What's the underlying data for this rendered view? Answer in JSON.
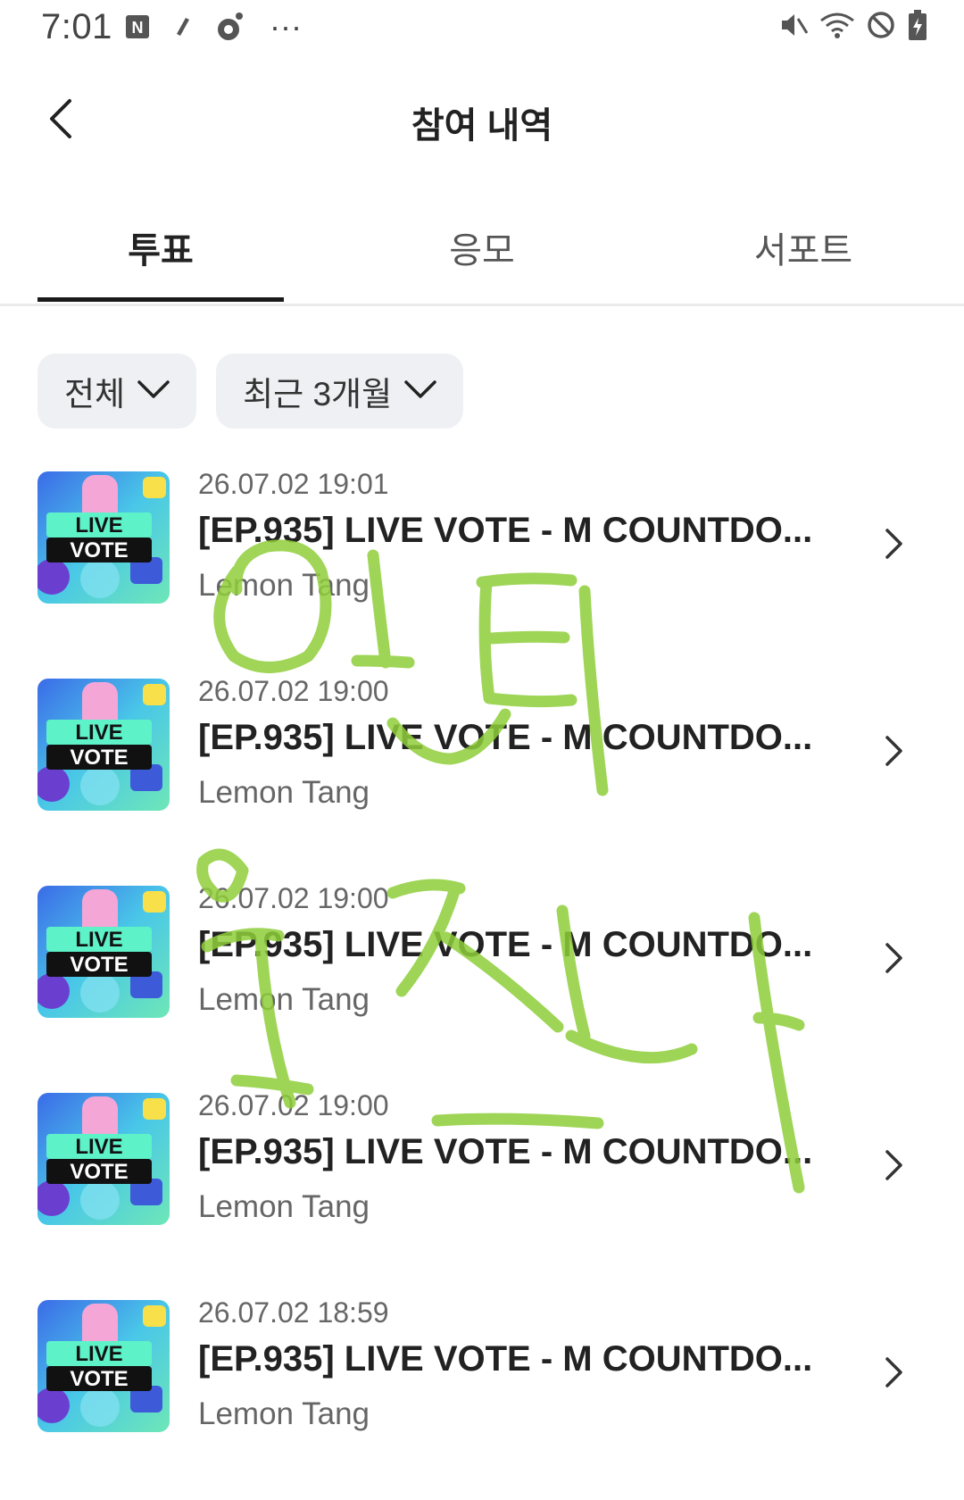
{
  "status_bar": {
    "time": "7:01",
    "more": "···",
    "left_icons": [
      "n-app-icon",
      "edit-icon",
      "camera-icon"
    ],
    "right_icons": [
      "mute-icon",
      "wifi-icon",
      "do-not-disturb-icon",
      "battery-charging-icon"
    ]
  },
  "header": {
    "title": "참여 내역",
    "back_icon": "chevron-left-icon"
  },
  "tabs": [
    {
      "label": "투표",
      "active": true
    },
    {
      "label": "응모",
      "active": false
    },
    {
      "label": "서포트",
      "active": false
    }
  ],
  "filters": [
    {
      "label": "전체"
    },
    {
      "label": "최근 3개월"
    }
  ],
  "list": [
    {
      "date": "26.07.02 19:01",
      "title": "[EP.935] LIVE VOTE - M COUNTDO...",
      "artist": "Lemon Tang"
    },
    {
      "date": "26.07.02 19:00",
      "title": "[EP.935] LIVE VOTE - M COUNTDO...",
      "artist": "Lemon Tang"
    },
    {
      "date": "26.07.02 19:00",
      "title": "[EP.935] LIVE VOTE - M COUNTDO...",
      "artist": "Lemon Tang"
    },
    {
      "date": "26.07.02 19:00",
      "title": "[EP.935] LIVE VOTE - M COUNTDO...",
      "artist": "Lemon Tang"
    },
    {
      "date": "26.07.02 18:59",
      "title": "[EP.935] LIVE VOTE - M COUNTDO...",
      "artist": "Lemon Tang"
    }
  ],
  "thumbnail": {
    "line1": "LIVE",
    "line2": "VOTE"
  },
  "colors": {
    "scribble": "#8fce3a",
    "tab_indicator": "#1a1a1a",
    "chip_bg": "#eef0f3"
  }
}
